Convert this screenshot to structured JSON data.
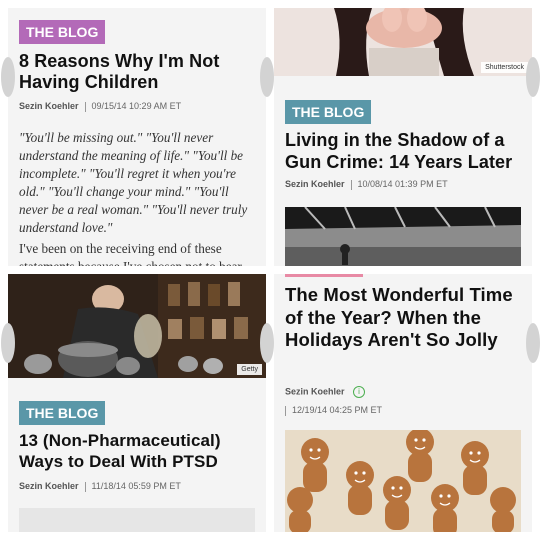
{
  "colors": {
    "tag_purple": "#b36ab8",
    "tag_teal": "#5a97a8",
    "divider_pink": "#e88aa5",
    "panel_bg": "#f4f4f4"
  },
  "card1": {
    "tag": "THE BLOG",
    "title": "8 Reasons Why I'm Not Having Children",
    "author": "Sezin Koehler",
    "date": "09/15/14 10:29 AM ET",
    "quote": "\"You'll be missing out.\" \"You'll never understand the meaning of life.\" \"You'll be incomplete.\" \"You'll regret it when you're old.\" \"You'll change your mind.\" \"You'll never be a real woman.\" \"You'll never truly understand love.\"",
    "para": "I've been on the receiving end of these statements because I've chosen not to bear"
  },
  "card2": {
    "image_credit": "Shutterstock",
    "tag": "THE BLOG",
    "title": "Living in the Shadow of a Gun Crime: 14 Years Later",
    "author": "Sezin Koehler",
    "date": "10/08/14 01:39 PM ET"
  },
  "card3": {
    "image_credit": "Getty",
    "tag": "THE BLOG",
    "title": "13 (Non-Pharmaceutical) Ways to Deal With PTSD",
    "author": "Sezin Koehler",
    "date": "11/18/14 05:59 PM ET"
  },
  "card4": {
    "title": "The Most Wonderful Time of the Year? When the Holidays Aren't So Jolly",
    "author": "Sezin Koehler",
    "info_icon": "info-circle-icon",
    "date": "12/19/14 04:25 PM ET"
  }
}
